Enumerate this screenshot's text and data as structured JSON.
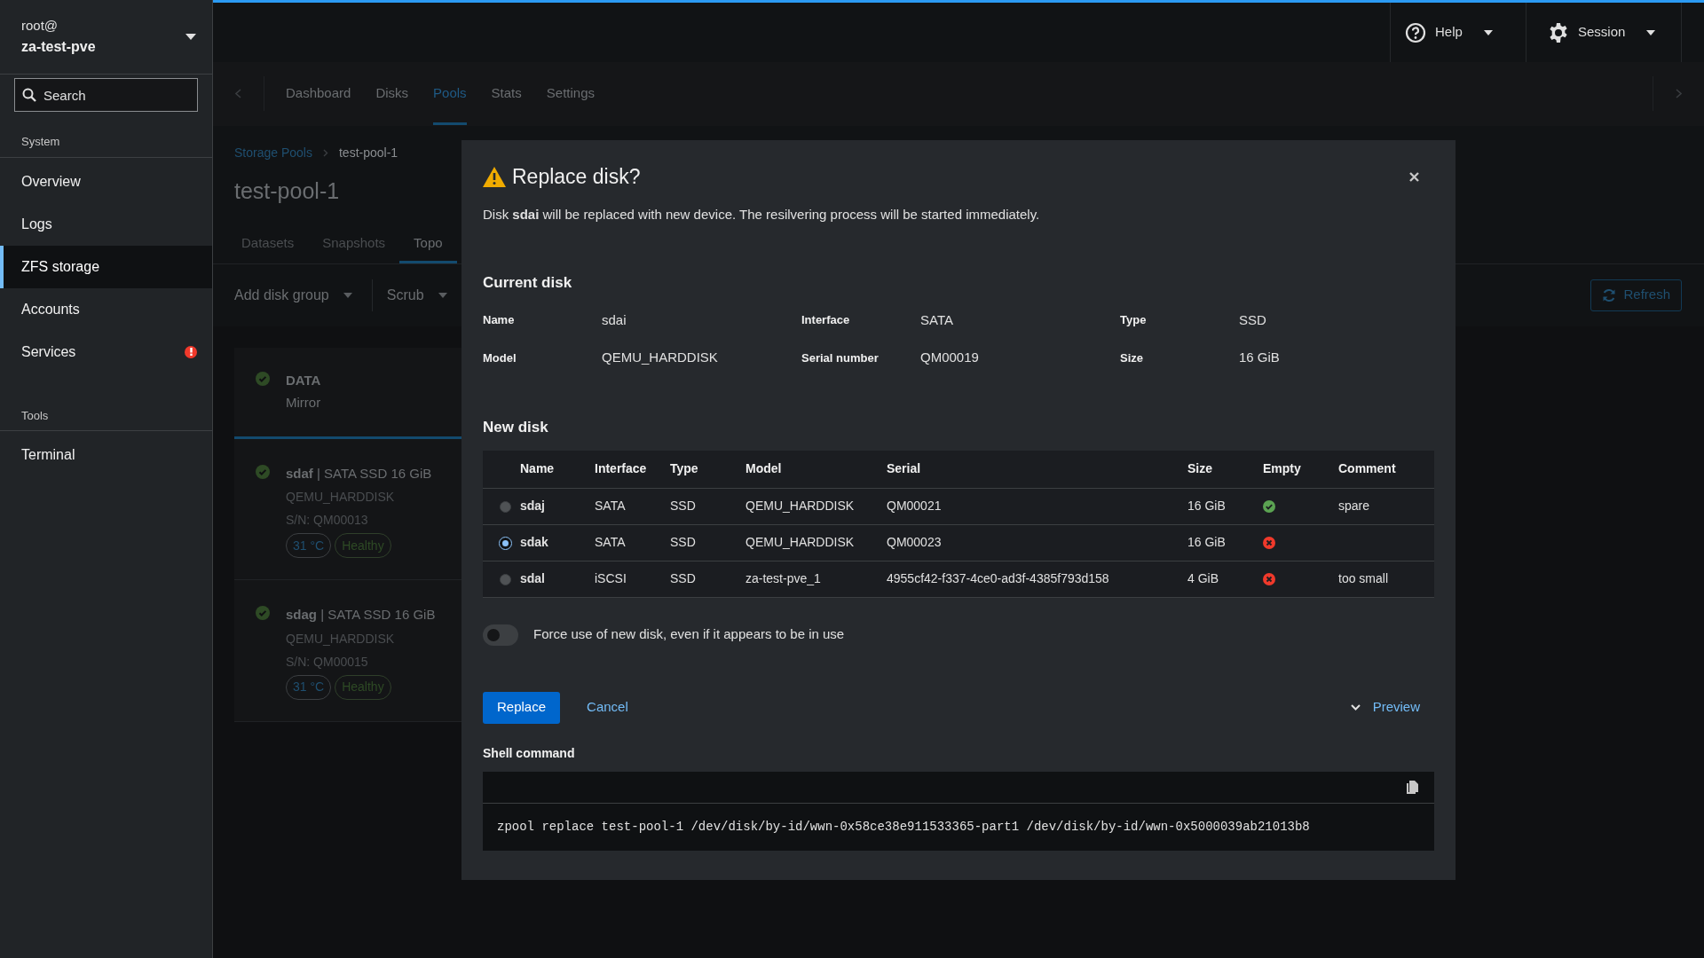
{
  "host": {
    "user": "root@",
    "name": "za-test-pve"
  },
  "search": {
    "placeholder": "Search"
  },
  "sidebar": {
    "sections": [
      {
        "title": "System",
        "items": [
          {
            "label": "Overview",
            "selected": false,
            "alert": false
          },
          {
            "label": "Logs",
            "selected": false,
            "alert": false
          },
          {
            "label": "ZFS storage",
            "selected": true,
            "alert": false
          },
          {
            "label": "Accounts",
            "selected": false,
            "alert": false
          },
          {
            "label": "Services",
            "selected": false,
            "alert": true
          }
        ]
      },
      {
        "title": "Tools",
        "items": [
          {
            "label": "Terminal",
            "selected": false,
            "alert": false
          }
        ]
      }
    ]
  },
  "top_bar": {
    "help": "Help",
    "session": "Session"
  },
  "nav_tabs": [
    {
      "label": "Dashboard",
      "selected": false
    },
    {
      "label": "Disks",
      "selected": false
    },
    {
      "label": "Pools",
      "selected": true
    },
    {
      "label": "Stats",
      "selected": false
    },
    {
      "label": "Settings",
      "selected": false
    }
  ],
  "breadcrumb": [
    "Storage Pools",
    "test-pool-1"
  ],
  "page_title": "test-pool-1",
  "page_tabs": [
    {
      "label": "Datasets",
      "selected": false
    },
    {
      "label": "Snapshots",
      "selected": false
    },
    {
      "label": "Topo",
      "selected": true
    }
  ],
  "toolbar": {
    "menus": [
      "Add disk group",
      "Scrub"
    ],
    "refresh": "Refresh"
  },
  "topology": {
    "group": {
      "name": "DATA",
      "layout": "Mirror"
    },
    "disks": [
      {
        "name": "sdaf",
        "details": "| SATA SSD 16 GiB",
        "model": "QEMU_HARDDISK",
        "serial": "S/N: QM00013",
        "temperature": "31 °C",
        "health": "Healthy"
      },
      {
        "name": "sdag",
        "details": "| SATA SSD 16 GiB",
        "model": "QEMU_HARDDISK",
        "serial": "S/N: QM00015",
        "temperature": "31 °C",
        "health": "Healthy"
      }
    ]
  },
  "dialog": {
    "title": "Replace disk?",
    "message": "Disk **sdai** will be replaced with new device. The resilvering process will be started immediately.",
    "current_disk": {
      "heading": "Current disk",
      "fields": [
        {
          "label": "Name",
          "value": "sdai"
        },
        {
          "label": "Interface",
          "value": "SATA"
        },
        {
          "label": "Type",
          "value": "SSD"
        },
        {
          "label": "Model",
          "value": "QEMU_HARDDISK"
        },
        {
          "label": "Serial number",
          "value": "QM00019"
        },
        {
          "label": "Size",
          "value": "16 GiB"
        }
      ]
    },
    "new_disk": {
      "heading": "New disk",
      "columns": [
        "Name",
        "Interface",
        "Type",
        "Model",
        "Serial",
        "Size",
        "Empty",
        "Comment"
      ],
      "rows": [
        {
          "selected": false,
          "name": "sdaj",
          "interface": "SATA",
          "type": "SSD",
          "model": "QEMU_HARDDISK",
          "serial": "QM00021",
          "size": "16 GiB",
          "empty": true,
          "comment": "spare"
        },
        {
          "selected": true,
          "name": "sdak",
          "interface": "SATA",
          "type": "SSD",
          "model": "QEMU_HARDDISK",
          "serial": "QM00023",
          "size": "16 GiB",
          "empty": false
        },
        {
          "selected": false,
          "name": "sdal",
          "interface": "iSCSI",
          "type": "SSD",
          "model": "za-test-pve_1",
          "serial": "4955cf42-f337-4ce0-ad3f-4385f793d158",
          "size": "4 GiB",
          "empty": false,
          "comment": "too small"
        }
      ]
    },
    "force": {
      "label": "Force use of new disk, even if it appears to be in use",
      "on": false
    },
    "actions": {
      "primary": "Replace",
      "cancel": "Cancel",
      "preview": "Preview"
    },
    "shell": {
      "label": "Shell command",
      "command": "zpool replace test-pool-1 /dev/disk/by-id/wwn-0x58ce38e911533365-part1 /dev/disk/by-id/wwn-0x5000039ab21013b8"
    }
  }
}
